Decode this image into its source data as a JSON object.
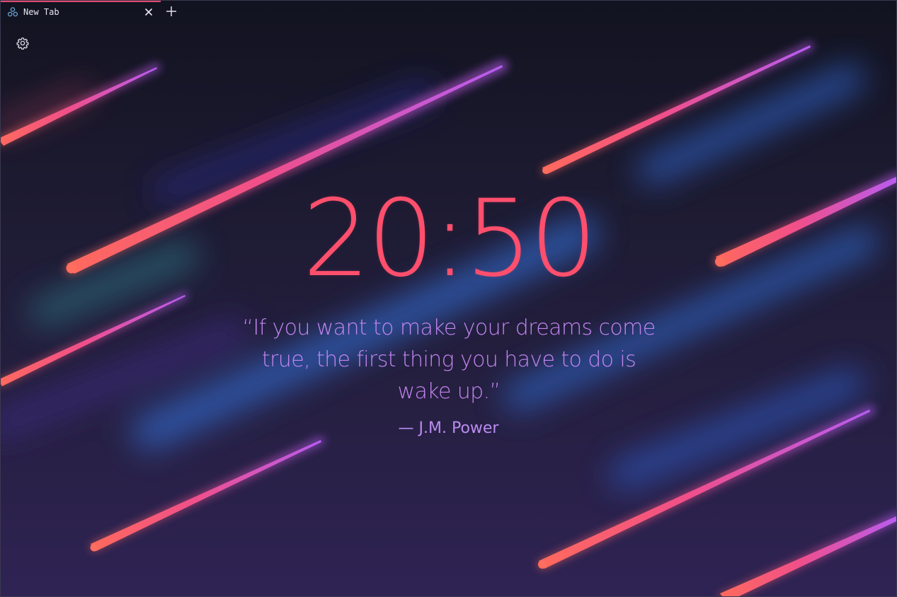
{
  "tab": {
    "title": "New Tab",
    "icon": "extension-logo-icon"
  },
  "toolbar": {
    "close_icon": "close-icon",
    "new_tab_icon": "plus-icon",
    "settings_icon": "gear-icon"
  },
  "clock": {
    "time": "20:50"
  },
  "quote": {
    "text": "“If you want to make your dreams come true, the first thing you have to do is wake up.”",
    "author": "— J.M. Power"
  },
  "colors": {
    "accent": "#ff4f6d",
    "quote": "#c385f0",
    "background_top": "#121320",
    "background_bottom": "#2f2354",
    "meteor_head": "#ff6f5b",
    "meteor_tail": "#c05ef0"
  }
}
